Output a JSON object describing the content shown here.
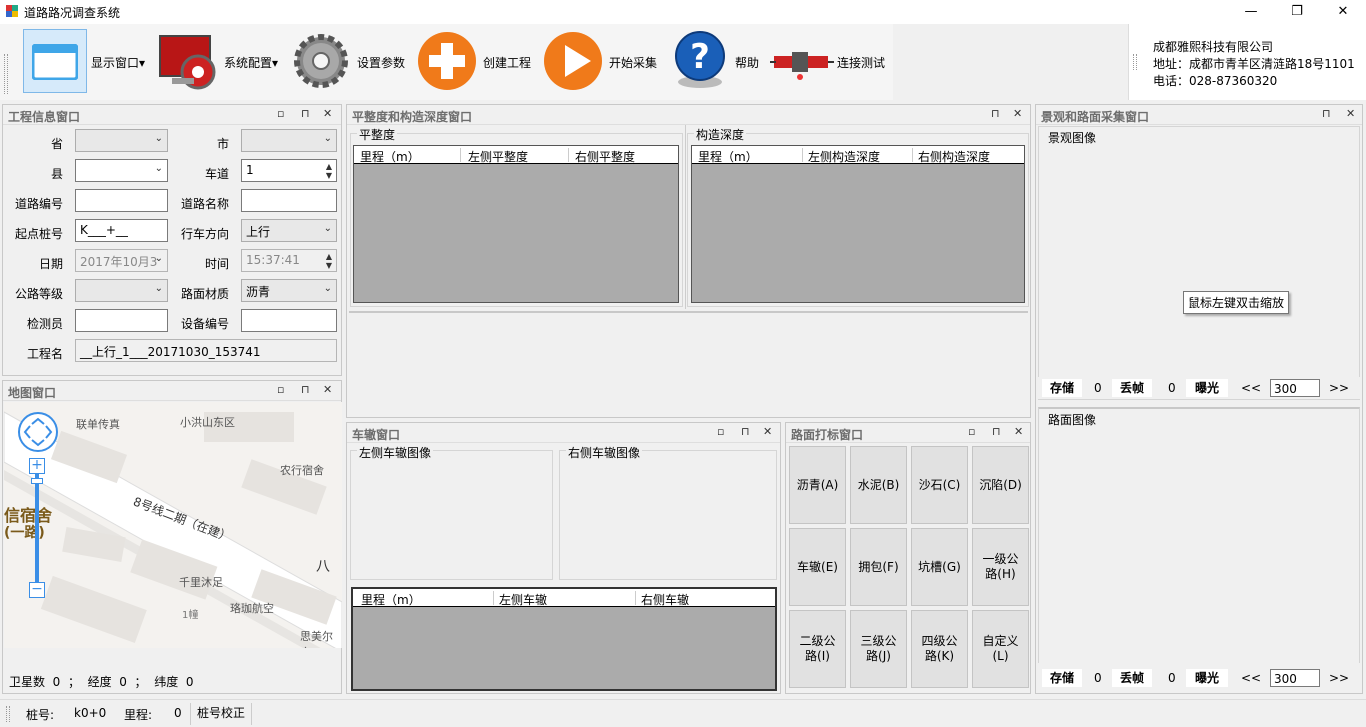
{
  "window": {
    "title": "道路路况调查系统",
    "controls": {
      "minimize": "—",
      "restore": "❐",
      "close": "✕"
    }
  },
  "toolbar": {
    "items": [
      {
        "label": "显示窗口",
        "dropdown": true
      },
      {
        "label": "系统配置",
        "dropdown": true
      },
      {
        "label": "设置参数"
      },
      {
        "label": "创建工程"
      },
      {
        "label": "开始采集"
      },
      {
        "label": "帮助"
      },
      {
        "label": "连接测试"
      }
    ],
    "dropdown_arrow": "▾"
  },
  "company": {
    "name": "成都雅熙科技有限公司",
    "address": "地址：成都市青羊区清涟路18号1101",
    "phone": "电话：028-87360320"
  },
  "project_panel": {
    "title": "工程信息窗口",
    "labels": {
      "province": "省",
      "city": "市",
      "county": "县",
      "lane": "车道",
      "road_no": "道路编号",
      "road_name": "道路名称",
      "start_stake": "起点桩号",
      "direction": "行车方向",
      "date": "日期",
      "time": "时间",
      "road_grade": "公路等级",
      "surface": "路面材质",
      "inspector": "检测员",
      "device_no": "设备编号",
      "project_name": "工程名"
    },
    "values": {
      "lane": "1",
      "start_stake": "K___+__",
      "direction": "上行",
      "date": "2017年10月3",
      "time": "15:37:41",
      "surface": "沥青",
      "project_name": "__上行_1___20171030_153741"
    }
  },
  "map_panel": {
    "title": "地图窗口",
    "places": [
      "联单传真",
      "小洪山东区",
      "农行宿舍",
      "8号线二期（在建）",
      "千里沐足",
      "珞珈航空",
      "1幢",
      "思美尔宾",
      "信宿舍",
      "(一路)",
      "八"
    ],
    "status": {
      "sat_label": "卫星数",
      "sat": "0",
      "lng_label": "经度",
      "lng": "0",
      "lat_label": "纬度",
      "lat": "0",
      "sep": "；"
    }
  },
  "flatness_panel": {
    "title": "平整度和构造深度窗口",
    "flat_group": "平整度",
    "flat_cols": [
      "里程（m）",
      "左侧平整度",
      "右侧平整度"
    ],
    "depth_group": "构造深度",
    "depth_cols": [
      "里程（m）",
      "左侧构造深度",
      "右侧构造深度"
    ]
  },
  "rut_panel": {
    "title": "车辙窗口",
    "left_img": "左侧车辙图像",
    "right_img": "右侧车辙图像",
    "cols": [
      "里程（m）",
      "左侧车辙",
      "右侧车辙"
    ]
  },
  "mark_panel": {
    "title": "路面打标窗口",
    "buttons": [
      "沥青(A)",
      "水泥(B)",
      "沙石(C)",
      "沉陷(D)",
      "车辙(E)",
      "拥包(F)",
      "坑槽(G)",
      "一级公路(H)",
      "二级公路(I)",
      "三级公路(J)",
      "四级公路(K)",
      "自定义(L)"
    ]
  },
  "image_panel": {
    "title": "景观和路面采集窗口",
    "scene_label": "景观图像",
    "road_label": "路面图像",
    "tooltip": "鼠标左键双击缩放",
    "bar": {
      "store": "存储",
      "store_val": "0",
      "drop": "丢帧",
      "drop_val": "0",
      "exposure": "曝光",
      "prev": "<<",
      "value": "300",
      "next": ">>"
    }
  },
  "statusbar": {
    "stake_label": "桩号:",
    "stake": "k0+0",
    "mileage_label": "里程:",
    "mileage": "0",
    "correct": "桩号校正"
  },
  "icons": {
    "pin": "⊓",
    "float": "▫",
    "close": "✕",
    "combo_arrow": "⌄"
  }
}
